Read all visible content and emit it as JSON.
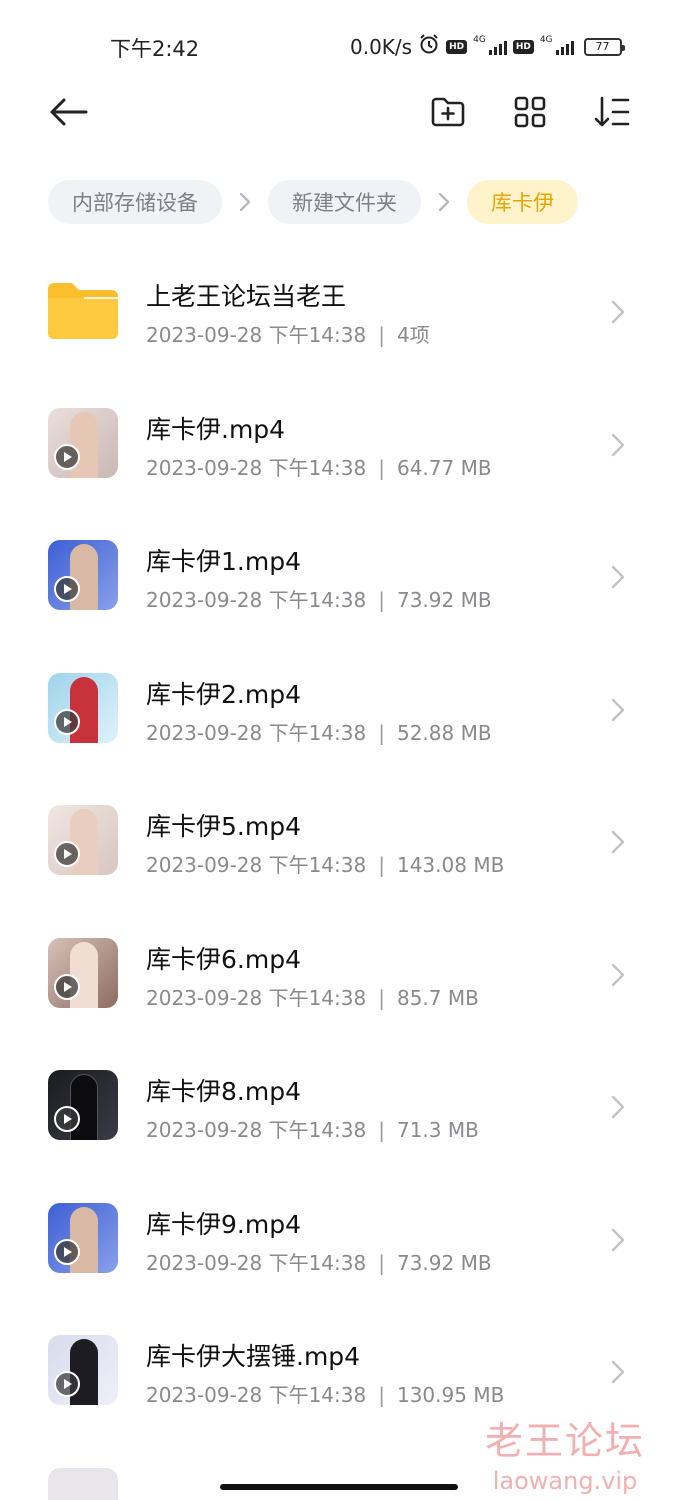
{
  "status_bar": {
    "time": "下午2:42",
    "speed": "0.0K/s",
    "hd_badge": "HD",
    "network": "4G",
    "battery": "77"
  },
  "toolbar": {
    "back_icon": "arrow-left-icon",
    "new_folder_icon": "folder-add-icon",
    "grid_icon": "grid-view-icon",
    "sort_icon": "sort-icon"
  },
  "breadcrumbs": [
    {
      "label": "内部存储设备"
    },
    {
      "label": "新建文件夹"
    },
    {
      "label": "库卡伊"
    }
  ],
  "folder": {
    "name": "上老王论坛当老王",
    "date": "2023-09-28 下午14:38",
    "detail": "4项"
  },
  "files": [
    {
      "name": "库卡伊.mp4",
      "date": "2023-09-28 下午14:38",
      "size": "64.77 MB"
    },
    {
      "name": "库卡伊1.mp4",
      "date": "2023-09-28 下午14:38",
      "size": "73.92 MB"
    },
    {
      "name": "库卡伊2.mp4",
      "date": "2023-09-28 下午14:38",
      "size": "52.88 MB"
    },
    {
      "name": "库卡伊5.mp4",
      "date": "2023-09-28 下午14:38",
      "size": "143.08 MB"
    },
    {
      "name": "库卡伊6.mp4",
      "date": "2023-09-28 下午14:38",
      "size": "85.7 MB"
    },
    {
      "name": "库卡伊8.mp4",
      "date": "2023-09-28 下午14:38",
      "size": "71.3 MB"
    },
    {
      "name": "库卡伊9.mp4",
      "date": "2023-09-28 下午14:38",
      "size": "73.92 MB"
    },
    {
      "name": "库卡伊大摆锤.mp4",
      "date": "2023-09-28 下午14:38",
      "size": "130.95 MB"
    }
  ],
  "meta_separator": "|",
  "watermark": {
    "title": "老王论坛",
    "url": "laowang.vip"
  },
  "colors": {
    "accent": "#e4a600",
    "active_crumb_bg": "#fff3cc",
    "folder": "#fbbf2d"
  }
}
